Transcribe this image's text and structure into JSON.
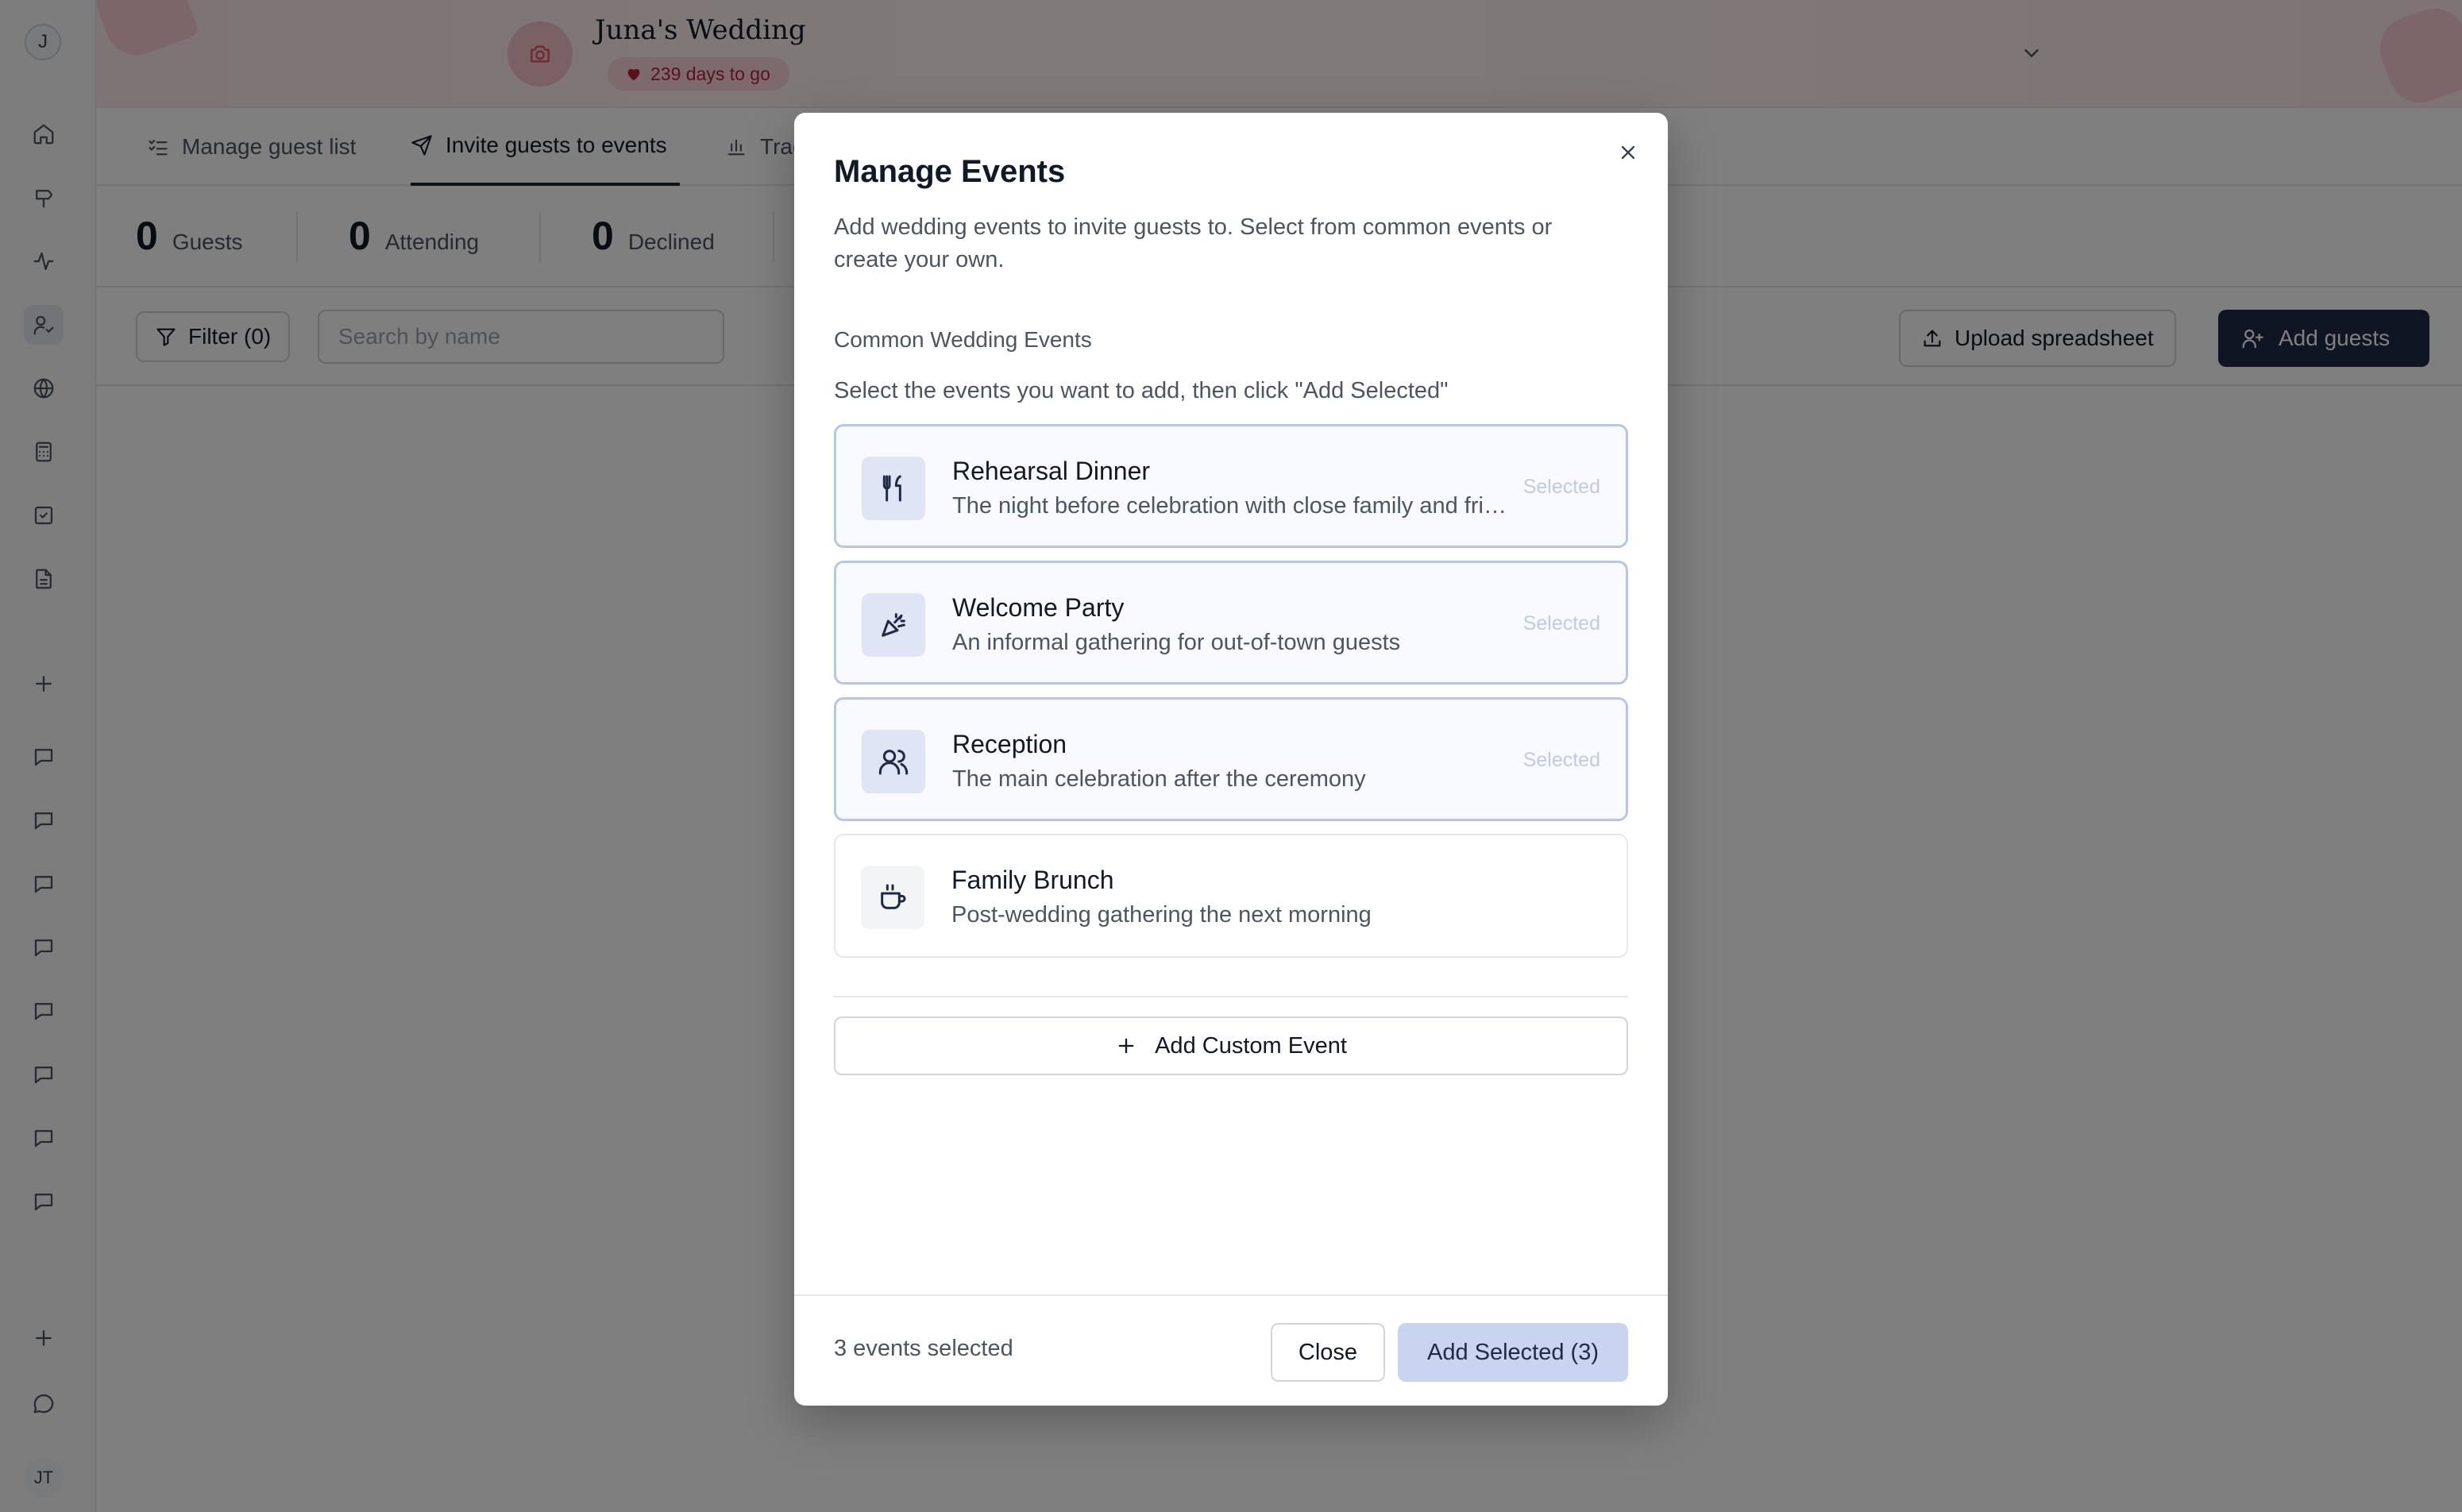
{
  "sidebar": {
    "top_avatar": "J",
    "bottom_avatar": "JT",
    "icons": [
      "home-icon",
      "signpost-icon",
      "activity-icon",
      "guests-icon",
      "globe-icon",
      "calculator-icon",
      "checklist-icon",
      "document-icon",
      "plus-icon",
      "chat-icon",
      "chat-icon",
      "chat-icon",
      "chat-icon",
      "chat-icon",
      "chat-icon",
      "chat-icon",
      "chat-icon",
      "plus-icon",
      "message-circle-icon"
    ]
  },
  "header": {
    "title": "Juna's Wedding",
    "countdown": "239 days to go",
    "colors": {
      "pill_bg": "#fbd5da",
      "pill_text": "#b4233a"
    }
  },
  "tabs": [
    {
      "label": "Manage guest list",
      "icon": "list-check-icon",
      "active": false
    },
    {
      "label": "Invite guests to events",
      "icon": "send-icon",
      "active": true
    },
    {
      "label": "Track RSVPs",
      "icon": "bar-chart-icon",
      "active": false
    }
  ],
  "stats": [
    {
      "value": "0",
      "label": "Guests"
    },
    {
      "value": "0",
      "label": "Attending"
    },
    {
      "value": "0",
      "label": "Declined"
    }
  ],
  "toolbar": {
    "filter_label": "Filter (0)",
    "search_placeholder": "Search by name",
    "upload_label": "Upload spreadsheet",
    "add_guests_label": "Add guests"
  },
  "modal": {
    "title": "Manage Events",
    "description": "Add wedding events to invite guests to. Select from common events or create your own.",
    "section_label": "Common Wedding Events",
    "section_hint": "Select the events you want to add, then click \"Add Selected\"",
    "events": [
      {
        "name": "Rehearsal Dinner",
        "description": "The night before celebration with close family and friends",
        "icon": "utensils-icon",
        "selected": true,
        "status": "Selected"
      },
      {
        "name": "Welcome Party",
        "description": "An informal gathering for out-of-town guests",
        "icon": "party-popper-icon",
        "selected": true,
        "status": "Selected"
      },
      {
        "name": "Reception",
        "description": "The main celebration after the ceremony",
        "icon": "users-icon",
        "selected": true,
        "status": "Selected"
      },
      {
        "name": "Family Brunch",
        "description": "Post-wedding gathering the next morning",
        "icon": "coffee-icon",
        "selected": false,
        "status": ""
      }
    ],
    "add_custom_label": "Add Custom Event",
    "footer": {
      "count_text": "3 events selected",
      "close_label": "Close",
      "add_selected_label": "Add Selected (3)"
    }
  }
}
